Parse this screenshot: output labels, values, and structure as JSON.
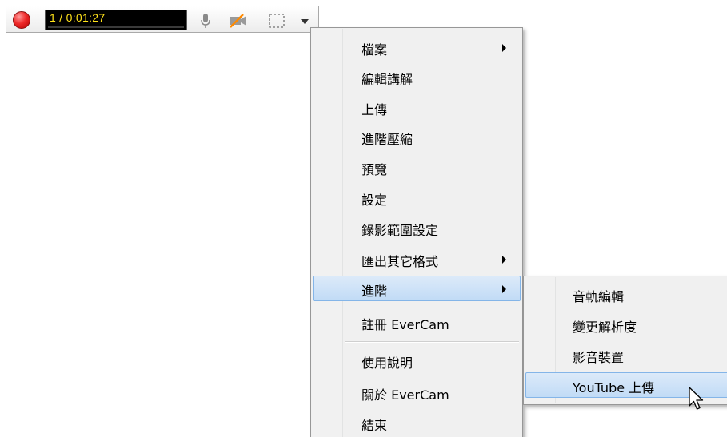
{
  "toolbar": {
    "timer": "1 / 0:01:27",
    "icons": [
      "record-icon",
      "microphone-icon",
      "camera-off-icon",
      "region-select-icon",
      "chevron-down-icon"
    ],
    "colors": {
      "timer_text": "#ffe21a",
      "record": "#ee2a2a"
    }
  },
  "main_menu": {
    "items": [
      {
        "label": "檔案",
        "has_submenu": true
      },
      {
        "label": "編輯講解",
        "has_submenu": false
      },
      {
        "label": "上傳",
        "has_submenu": false
      },
      {
        "label": "進階壓縮",
        "has_submenu": false
      },
      {
        "label": "預覽",
        "has_submenu": false
      },
      {
        "label": "設定",
        "has_submenu": false
      },
      {
        "label": "錄影範圍設定",
        "has_submenu": false
      },
      {
        "label": "匯出其它格式",
        "has_submenu": true
      },
      {
        "label": "進階",
        "has_submenu": true,
        "highlighted": true
      },
      {
        "label": "註冊 EverCam",
        "has_submenu": false
      },
      {
        "label": "使用說明",
        "has_submenu": false
      },
      {
        "label": "關於 EverCam",
        "has_submenu": false
      },
      {
        "label": "結束",
        "has_submenu": false
      }
    ]
  },
  "sub_menu": {
    "items": [
      {
        "label": "音軌編輯"
      },
      {
        "label": "變更解析度"
      },
      {
        "label": "影音裝置"
      },
      {
        "label": "YouTube 上傳",
        "highlighted": true
      }
    ]
  },
  "colors": {
    "menu_bg": "#f0f0f0",
    "highlight_bg": "#cce0f8",
    "highlight_border": "#84b5e8"
  }
}
